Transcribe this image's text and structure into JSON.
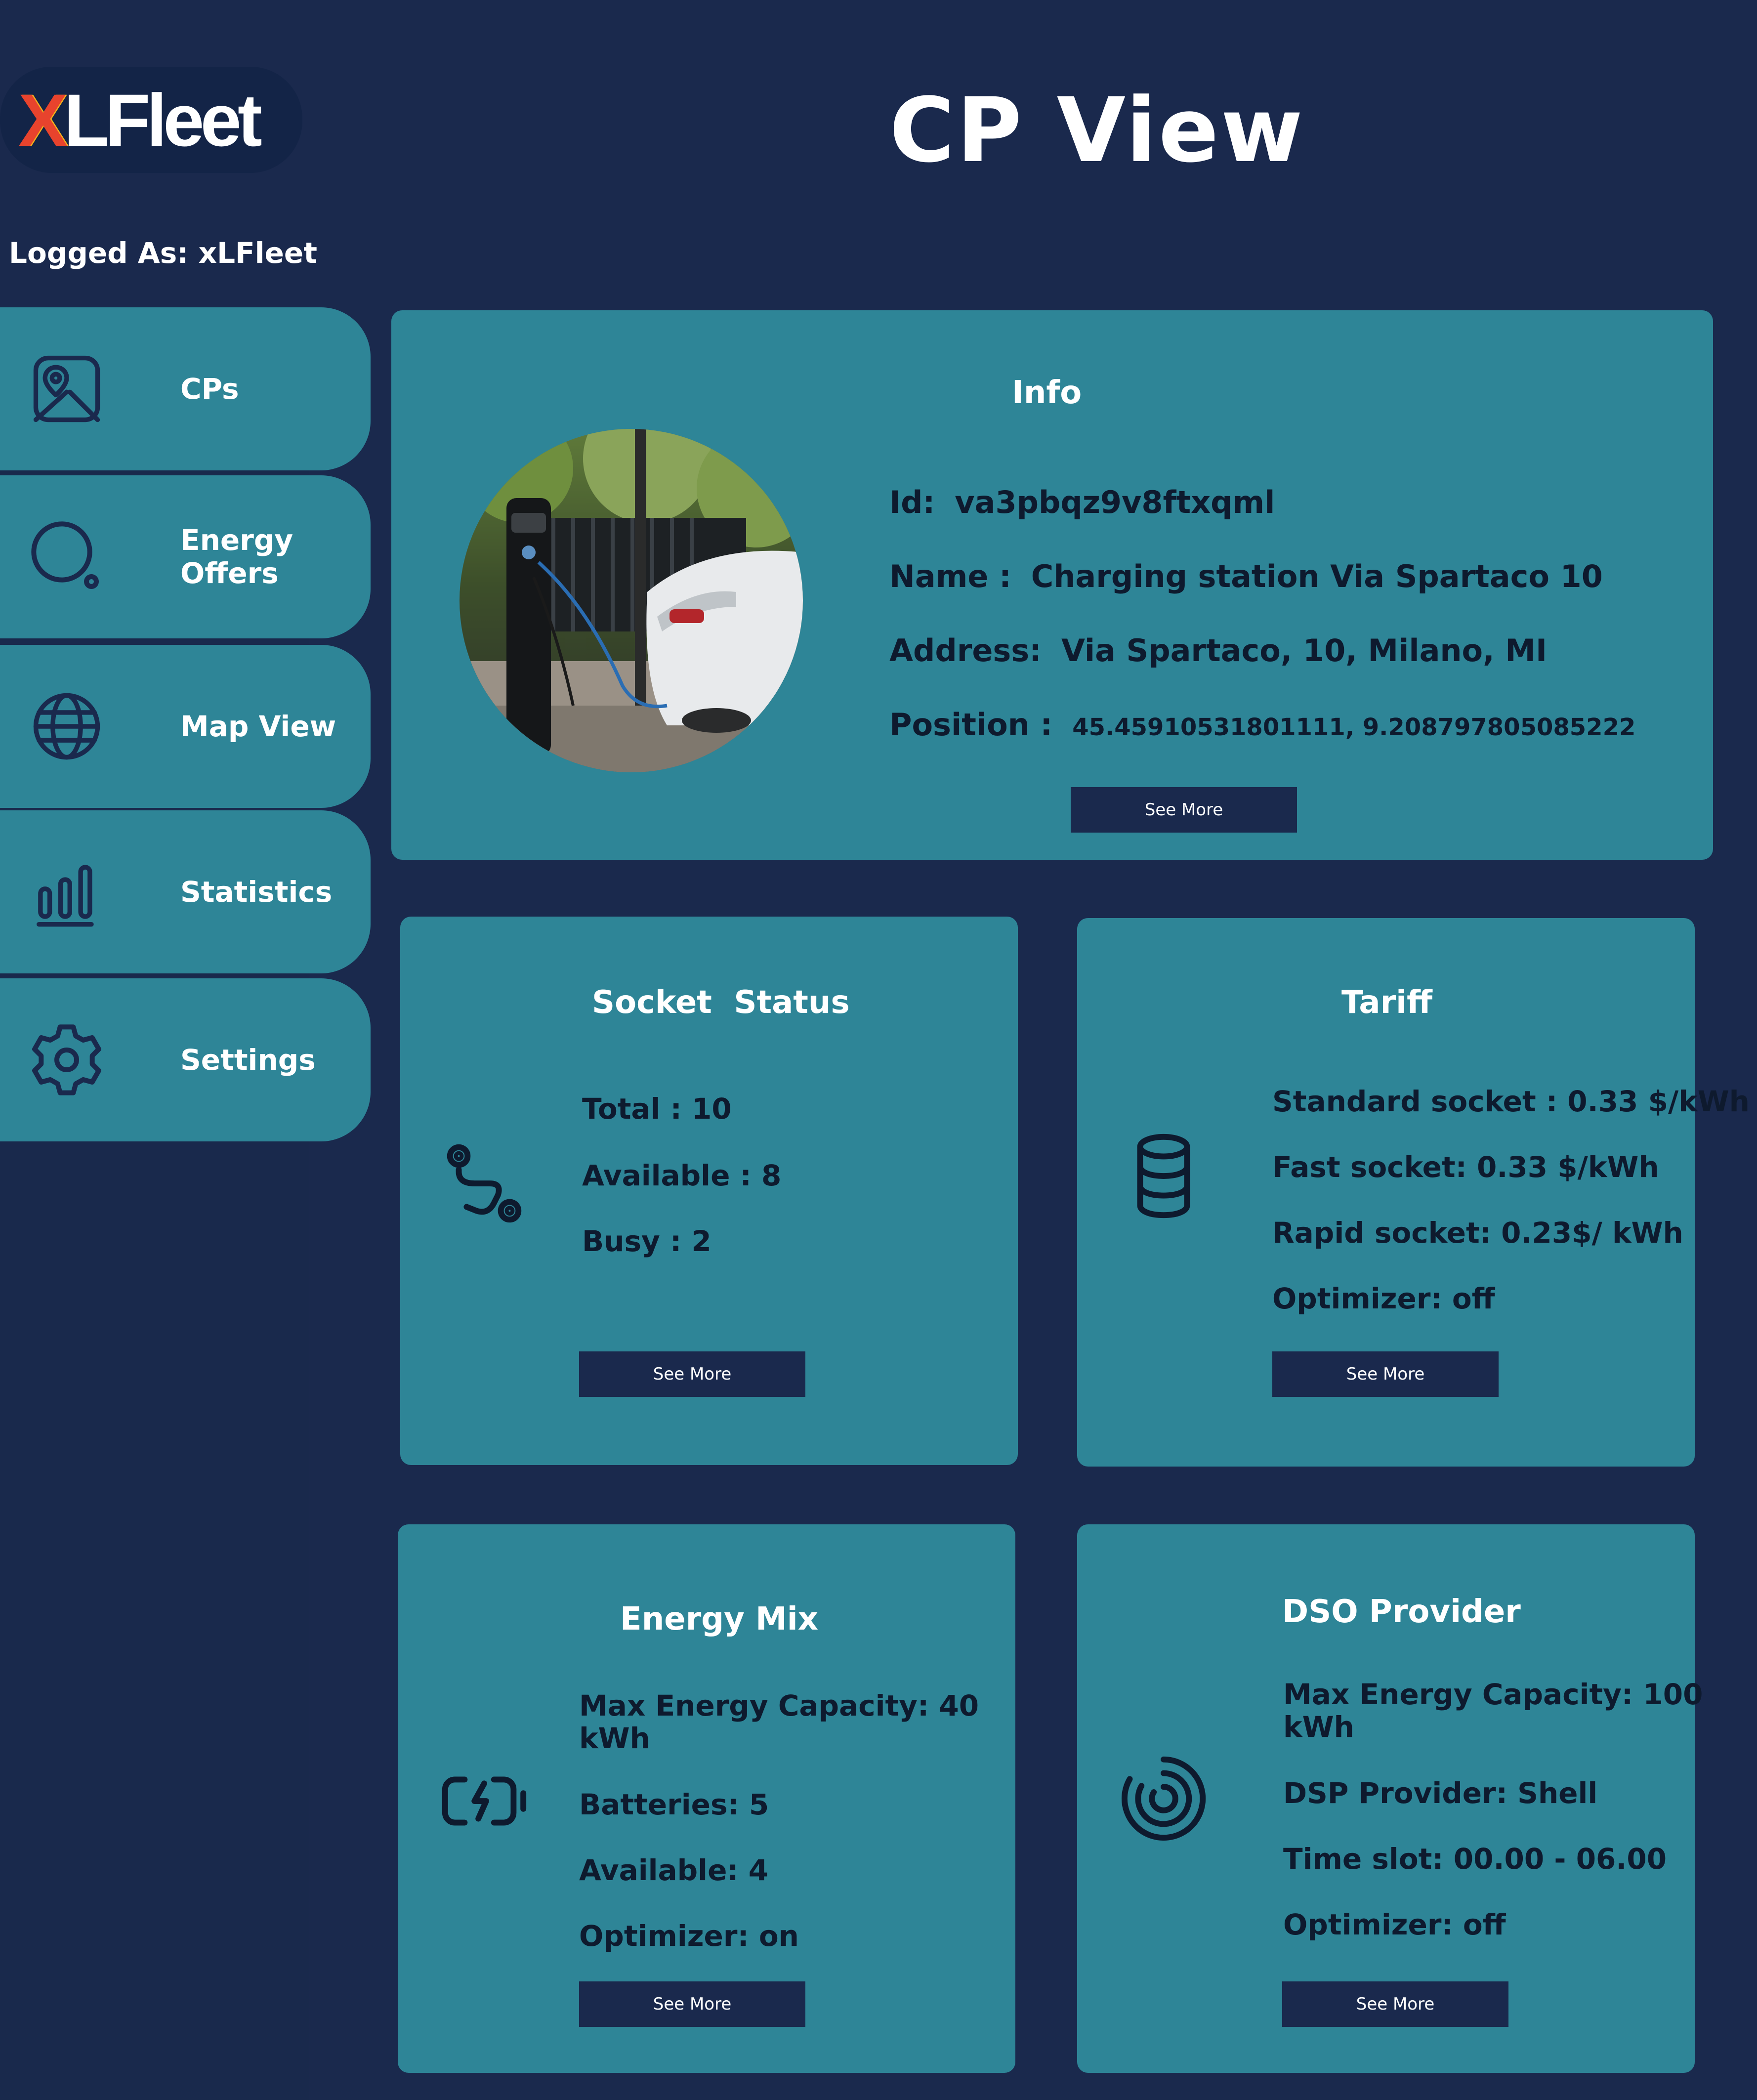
{
  "app": {
    "logo_text": "XLFleet",
    "page_title": "CP View",
    "logged_as": "Logged As: xLFleet"
  },
  "sidebar": {
    "items": [
      {
        "label": "CPs",
        "icon": "map-image-icon"
      },
      {
        "label": "Energy Offers",
        "icon": "search-icon"
      },
      {
        "label": "Map View",
        "icon": "globe-icon"
      },
      {
        "label": "Statistics",
        "icon": "bar-chart-icon"
      },
      {
        "label": "Settings",
        "icon": "gear-icon"
      }
    ]
  },
  "info": {
    "title": "Info",
    "id_label": "Id:",
    "id_value": "va3pbqz9v8ftxqml",
    "name_label": "Name :",
    "name_value": "Charging station Via Spartaco 10",
    "address_label": "Address:",
    "address_value": "Via Spartaco, 10, Milano, MI",
    "position_label": "Position :",
    "position_value": "45.45910531801111, 9.208797805085222",
    "button": "See More"
  },
  "socket_status": {
    "title": "Socket  Status",
    "lines": [
      "Total : 10",
      "Available : 8",
      "Busy : 2"
    ],
    "button": "See More",
    "icon": "route-icon"
  },
  "tariff": {
    "title": "Tariff",
    "lines": [
      "Standard socket : 0.33 $/kWh",
      "Fast socket: 0.33 $/kWh",
      "Rapid socket: 0.23$/ kWh",
      "Optimizer: off"
    ],
    "button": "See More",
    "icon": "database-icon"
  },
  "energy_mix": {
    "title": "Energy Mix",
    "capacity_1": "Max Energy Capacity:  40",
    "capacity_2": "kWh",
    "lines": [
      "Batteries: 5",
      "Available: 4",
      "Optimizer: on"
    ],
    "button": "See More",
    "icon": "battery-charging-icon"
  },
  "dso_provider": {
    "title": "DSO Provider",
    "capacity_1": "Max Energy Capacity: 100",
    "capacity_2": "kWh",
    "lines": [
      "DSP Provider: Shell",
      "Time slot: 00.00 - 06.00",
      "Optimizer: off"
    ],
    "button": "See More",
    "icon": "spiral-icon"
  },
  "colors": {
    "background": "#1a294d",
    "card": "#2e8597",
    "button": "#1a294d",
    "text_dark": "#0e1a2e",
    "text_light": "#ffffff"
  }
}
